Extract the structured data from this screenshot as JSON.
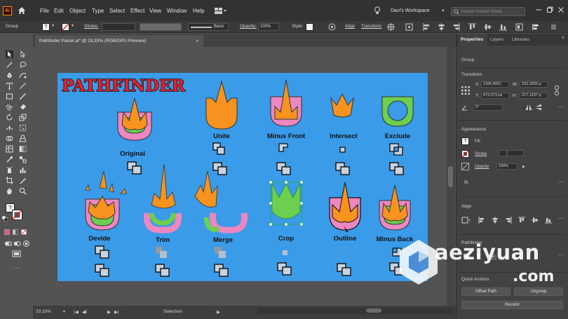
{
  "app": {
    "logo": "Ai",
    "menu": [
      "File",
      "Edit",
      "Object",
      "Type",
      "Select",
      "Effect",
      "View",
      "Window",
      "Help"
    ]
  },
  "workspace": {
    "label": "Davi's Workspace",
    "search_placeholder": "Search Adobe Stock"
  },
  "control_bar": {
    "selection_type": "Group",
    "fill_glyph": "?",
    "stroke_label": "Stroke:",
    "brush_label": "Basic",
    "opacity_label": "Opacity:",
    "opacity_value": "100%",
    "style_label": "Style:",
    "align_label": "Align",
    "transform_label": "Transform"
  },
  "document": {
    "tab_title": "Pathfinder Painel.ai* @ 33,33% (RGB/GPU Preview)",
    "close_glyph": "×"
  },
  "artboard": {
    "title": "PATHFINDER",
    "labels": {
      "original": "Original",
      "unite": "Unite",
      "minus_front": "Minus Front",
      "intersect": "Intersect",
      "exclude": "Exclude",
      "divide": "Devide",
      "trim": "Trim",
      "merge": "Merge",
      "crop": "Crop",
      "outline": "Outline",
      "minus_back": "Minus Back"
    },
    "colors": {
      "background": "#3a9be8",
      "orange": "#f7931e",
      "pink": "#ec87c0",
      "green": "#6ccf4f",
      "title_red": "#e8202a"
    }
  },
  "status_bar": {
    "zoom": "33,33%",
    "artboard_number": "1",
    "tool": "Selection"
  },
  "properties": {
    "tabs": [
      "Properties",
      "Layers",
      "Libraries"
    ],
    "selection": "Group",
    "transform": {
      "heading": "Transform",
      "x_label": "X:",
      "x": "1183,4061",
      "y_label": "Y:",
      "y": "673,573 px",
      "w_label": "W:",
      "w": "152,3259 p",
      "h_label": "H:",
      "h": "217,1237 p",
      "angle": "0°"
    },
    "appearance": {
      "heading": "Appearance",
      "fill_label": "Fill",
      "stroke_label": "Stroke",
      "opacity_label": "Opacity",
      "opacity_value": "100%",
      "fx_label": "fx."
    },
    "align": {
      "heading": "Align"
    },
    "pathfinder": {
      "heading": "Pathfinder"
    },
    "quick_actions": {
      "heading": "Quick Actions",
      "offset_path": "Offset Path",
      "ungroup": "Ungroup",
      "recolor": "Recolor"
    }
  },
  "watermark": {
    "text": "aeziyuan",
    "suffix": ".com"
  }
}
